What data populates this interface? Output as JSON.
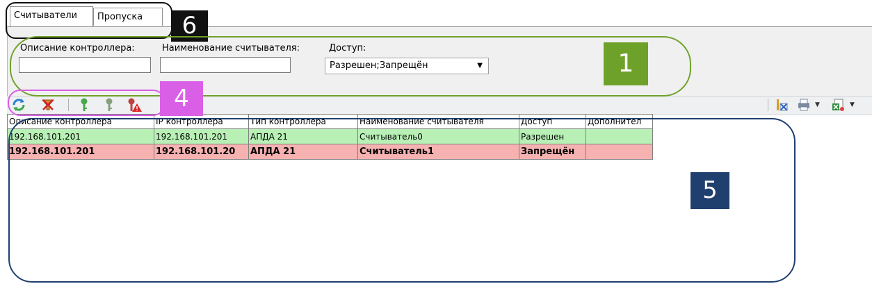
{
  "tabs": [
    {
      "label": "Считыватели",
      "active": true
    },
    {
      "label": "Пропуска",
      "active": false
    }
  ],
  "filters": {
    "controller_description_label": "Описание контроллера:",
    "controller_description_value": "",
    "reader_name_label": "Наименование считывателя:",
    "reader_name_value": "",
    "access_label": "Доступ:",
    "access_value": "Разрешен;Запрещён"
  },
  "toolbar": {
    "left_icons": [
      "refresh-icon",
      "clear-filter-icon",
      "key-green-icon",
      "key-gray-icon",
      "key-red-warning-icon"
    ],
    "right_icons": [
      "column-settings-icon",
      "print-icon",
      "export-icon"
    ]
  },
  "table": {
    "columns": [
      "Описание контроллера",
      "IP контроллера",
      "Тип контроллера",
      "Наименование считывателя",
      "Доступ",
      "Дополнител"
    ],
    "rows": [
      {
        "status": "allowed",
        "cells": [
          "192.168.101.201",
          "192.168.101.201",
          "АПДА 21",
          "Считыватель0",
          "Разрешен",
          ""
        ]
      },
      {
        "status": "denied",
        "cells": [
          "192.168.101.201",
          "192.168.101.20",
          "АПДА 21",
          "Считыватель1",
          "Запрещён",
          ""
        ]
      }
    ]
  },
  "annotations": {
    "n1": "1",
    "n4": "4",
    "n5": "5",
    "n6": "6"
  },
  "colors": {
    "allowed_row": "#b8f0b6",
    "denied_row": "#f6b1b1",
    "callout_green": "#6ea12a",
    "callout_magenta": "#d95fe6",
    "callout_navy": "#1f3f6e",
    "callout_black": "#111111"
  }
}
